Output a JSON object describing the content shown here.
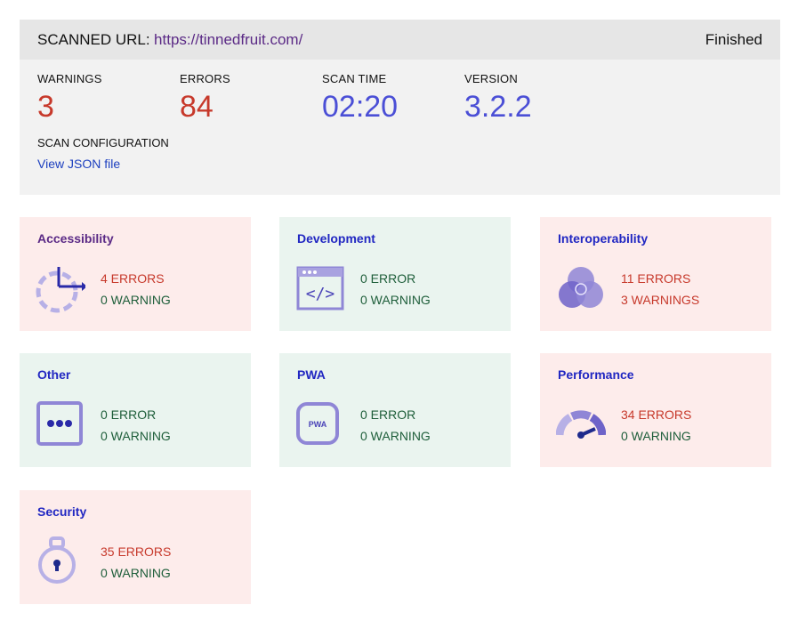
{
  "header": {
    "scanned_label": "SCANNED URL:",
    "url": "https://tinnedfruit.com/",
    "status": "Finished"
  },
  "summary": {
    "warnings_label": "WARNINGS",
    "warnings_value": "3",
    "errors_label": "ERRORS",
    "errors_value": "84",
    "scan_time_label": "SCAN TIME",
    "scan_time_value": "02:20",
    "version_label": "VERSION",
    "version_value": "3.2.2",
    "config_label": "SCAN CONFIGURATION",
    "config_link": "View JSON file"
  },
  "colors": {
    "error_red": "#c7392b",
    "accent_blue": "#4b4fd6",
    "card_bad_bg": "#fdeceb",
    "card_good_bg": "#eaf4ef",
    "icon_purple": "#8f86d6"
  },
  "cards": [
    {
      "title": "Accessibility",
      "icon": "accessibility-icon",
      "errors": "4 ERRORS",
      "warnings": "0 WARNING"
    },
    {
      "title": "Development",
      "icon": "code-window-icon",
      "errors": "0 ERROR",
      "warnings": "0 WARNING"
    },
    {
      "title": "Interoperability",
      "icon": "venn-circles-icon",
      "errors": "11 ERRORS",
      "warnings": "3 WARNINGS"
    },
    {
      "title": "Other",
      "icon": "more-dots-icon",
      "errors": "0 ERROR",
      "warnings": "0 WARNING"
    },
    {
      "title": "PWA",
      "icon": "pwa-icon",
      "icon_text": "PWA",
      "errors": "0 ERROR",
      "warnings": "0 WARNING"
    },
    {
      "title": "Performance",
      "icon": "gauge-icon",
      "errors": "34 ERRORS",
      "warnings": "0 WARNING"
    },
    {
      "title": "Security",
      "icon": "lock-icon",
      "errors": "35 ERRORS",
      "warnings": "0 WARNING"
    }
  ]
}
